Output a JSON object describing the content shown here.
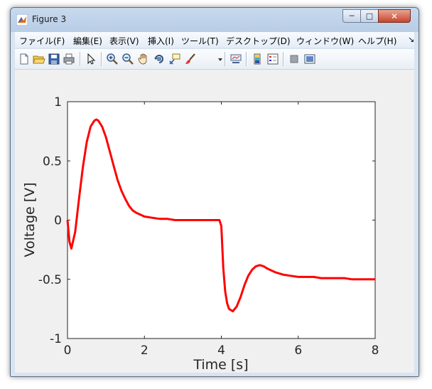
{
  "window": {
    "title": "Figure 3"
  },
  "menu": [
    "ファイル(F)",
    "編集(E)",
    "表示(V)",
    "挿入(I)",
    "ツール(T)",
    "デスクトップ(D)",
    "ウィンドウ(W)",
    "ヘルプ(H)"
  ],
  "toolbar": [
    "new-figure-icon",
    "open-file-icon",
    "save-icon",
    "print-icon",
    "pointer-icon",
    "zoom-in-icon",
    "zoom-out-icon",
    "pan-hand-icon",
    "rotate-3d-icon",
    "data-cursor-icon",
    "brush-icon",
    "link-plot-icon",
    "colorbar-icon",
    "legend-icon",
    "hide-plot-tools-icon",
    "show-plot-tools-icon"
  ],
  "chart_data": {
    "type": "line",
    "xlabel": "Time [s]",
    "ylabel": "Voltage [V]",
    "xlim": [
      0,
      8
    ],
    "ylim": [
      -1,
      1
    ],
    "xticks": [
      "0",
      "2",
      "4",
      "6",
      "8"
    ],
    "yticks": [
      "-1",
      "-0.5",
      "0",
      "0.5",
      "1"
    ],
    "grid": false,
    "series": [
      {
        "color": "#ff0000",
        "x": [
          0,
          0.05,
          0.1,
          0.2,
          0.3,
          0.4,
          0.5,
          0.6,
          0.7,
          0.75,
          0.8,
          0.9,
          1.0,
          1.1,
          1.2,
          1.3,
          1.4,
          1.5,
          1.6,
          1.7,
          1.8,
          2.0,
          2.2,
          2.4,
          2.6,
          2.8,
          3.0,
          3.2,
          3.4,
          3.6,
          3.8,
          3.95,
          4.0,
          4.05,
          4.1,
          4.15,
          4.2,
          4.3,
          4.4,
          4.5,
          4.6,
          4.7,
          4.8,
          4.9,
          5.0,
          5.1,
          5.2,
          5.4,
          5.6,
          5.8,
          6.0,
          6.2,
          6.4,
          6.6,
          6.8,
          7.0,
          7.2,
          7.4,
          7.6,
          7.8,
          8.0
        ],
        "values": [
          0.0,
          -0.18,
          -0.24,
          -0.1,
          0.18,
          0.45,
          0.66,
          0.79,
          0.84,
          0.85,
          0.84,
          0.79,
          0.7,
          0.58,
          0.46,
          0.34,
          0.25,
          0.18,
          0.12,
          0.08,
          0.06,
          0.03,
          0.02,
          0.01,
          0.01,
          0.0,
          0.0,
          0.0,
          0.0,
          0.0,
          0.0,
          0.0,
          -0.05,
          -0.4,
          -0.6,
          -0.7,
          -0.75,
          -0.77,
          -0.73,
          -0.65,
          -0.55,
          -0.47,
          -0.42,
          -0.39,
          -0.38,
          -0.39,
          -0.41,
          -0.44,
          -0.46,
          -0.47,
          -0.48,
          -0.48,
          -0.48,
          -0.49,
          -0.49,
          -0.49,
          -0.49,
          -0.5,
          -0.5,
          -0.5,
          -0.5
        ]
      }
    ]
  }
}
